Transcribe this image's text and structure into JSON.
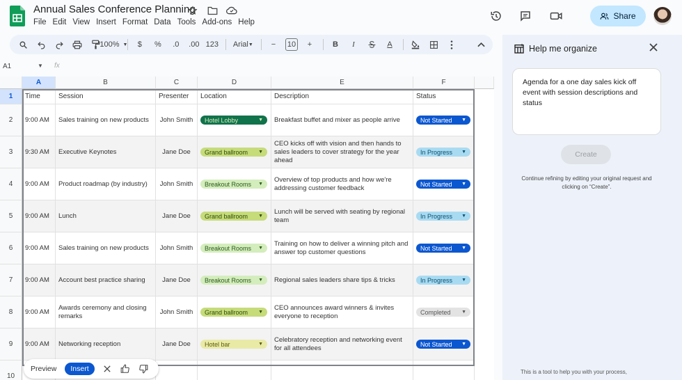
{
  "document": {
    "title": "Annual Sales Conference Planning"
  },
  "menu": [
    "File",
    "Edit",
    "View",
    "Insert",
    "Format",
    "Data",
    "Tools",
    "Add-ons",
    "Help"
  ],
  "header": {
    "share_label": "Share"
  },
  "toolbar": {
    "zoom": "100%",
    "currency": "$",
    "percent": "%",
    "dec_decrease": ".0",
    "dec_increase": ".00",
    "number_format": "123",
    "font": "Arial",
    "font_size": "10",
    "bold": "B",
    "text_color": "A"
  },
  "namebox": {
    "cell": "A1",
    "fx": "fx"
  },
  "grid": {
    "columns": [
      "A",
      "B",
      "C",
      "D",
      "E",
      "F"
    ],
    "rows": [
      "1",
      "2",
      "3",
      "4",
      "5",
      "6",
      "7",
      "8",
      "9",
      "10"
    ],
    "headers": {
      "time": "Time",
      "session": "Session",
      "presenter": "Presenter",
      "location": "Location",
      "description": "Description",
      "status": "Status"
    },
    "data": [
      {
        "time": "9:00 AM",
        "session": "Sales training on new products",
        "presenter": "John Smith",
        "location": "Hotel Lobby",
        "description": "Breakfast buffet and mixer as people arrive",
        "status": "Not Started"
      },
      {
        "time": "9:30 AM",
        "session": "Executive Keynotes",
        "presenter": "Jane Doe",
        "location": "Grand ballroom",
        "description": "CEO kicks off with vision and then hands to sales leaders to cover strategy for the year ahead",
        "status": "In Progress"
      },
      {
        "time": "9:00 AM",
        "session": "Product roadmap (by industry)",
        "presenter": "John Smith",
        "location": "Breakout Rooms",
        "description": "Overview of top products and how we're addressing customer feedback",
        "status": "Not Started"
      },
      {
        "time": "9:00 AM",
        "session": "Lunch",
        "presenter": "Jane Doe",
        "location": "Grand ballroom",
        "description": "Lunch will be served with seating by regional team",
        "status": "In Progress"
      },
      {
        "time": "9:00 AM",
        "session": "Sales training on new products",
        "presenter": "John Smith",
        "location": "Breakout Rooms",
        "description": "Training on how to deliver a winning pitch and answer top customer questions",
        "status": "Not Started"
      },
      {
        "time": "9:00 AM",
        "session": "Account best practice sharing",
        "presenter": "Jane Doe",
        "location": "Breakout Rooms",
        "description": "Regional sales leaders share tips & tricks",
        "status": "In Progress"
      },
      {
        "time": "9:00 AM",
        "session": "Awards ceremony and closing remarks",
        "presenter": "John Smith",
        "location": "Grand ballroom",
        "description": "CEO announces award winners & invites everyone to reception",
        "status": "Completed"
      },
      {
        "time": "9:00 AM",
        "session": "Networking reception",
        "presenter": "Jane Doe",
        "location": "Hotel bar",
        "description": "Celebratory reception and networking event for all attendees",
        "status": "Not Started"
      }
    ]
  },
  "floatbar": {
    "preview": "Preview",
    "insert": "Insert"
  },
  "panel": {
    "title": "Help me organize",
    "prompt": "Agenda for a one day sales kick off event with session descriptions and status",
    "create_label": "Create",
    "hint": "Continue refining by editing your original request and clicking on “Create”.",
    "footer": "This is a tool to help you with your process,"
  },
  "icons": [
    "sheets-logo-icon",
    "star-icon",
    "folder-icon",
    "cloud-icon",
    "history-icon",
    "comment-icon",
    "video-icon",
    "person-icon",
    "search-icon",
    "undo-icon",
    "redo-icon",
    "print-icon",
    "paint-format-icon",
    "strikethrough-icon",
    "fill-color-icon",
    "borders-icon",
    "more-icon",
    "chevron-up-icon",
    "table-icon",
    "close-icon",
    "thumbs-up-icon",
    "thumbs-down-icon"
  ]
}
